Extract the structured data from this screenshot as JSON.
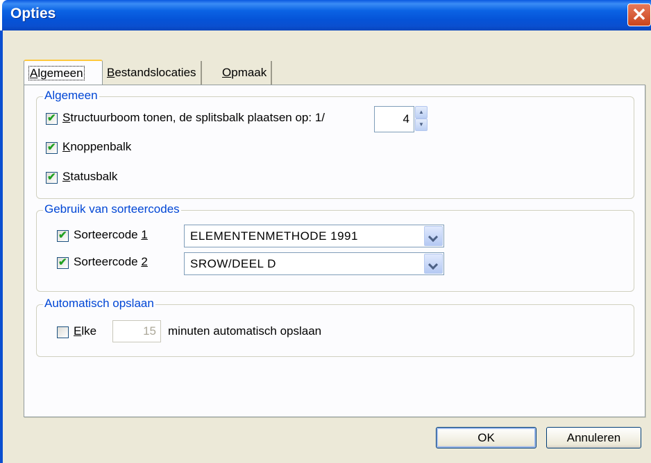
{
  "window": {
    "title": "Opties"
  },
  "tabs": [
    {
      "label": "Algemeen",
      "access_key": "A",
      "rest": "lgemeen",
      "active": true
    },
    {
      "label": "Bestandslocaties",
      "access_key": "B",
      "rest": "estandslocaties",
      "active": false
    },
    {
      "label": "Opmaak",
      "access_key": "O",
      "rest": "pmaak",
      "active": false
    }
  ],
  "general": {
    "legend": "Algemeen",
    "tree": {
      "key": "S",
      "rest": "tructuurboom tonen, de splitsbalk plaatsen op: 1/",
      "checked": true,
      "value": "4"
    },
    "toolbar": {
      "key": "K",
      "rest": "noppenbalk",
      "checked": true
    },
    "statusbar": {
      "key": "S",
      "rest": "tatusbalk",
      "checked": true
    }
  },
  "sort": {
    "legend": "Gebruik van sorteercodes",
    "code1": {
      "prefix": "Sorteercode ",
      "key": "1",
      "checked": true,
      "selected": "ELEMENTENMETHODE 1991"
    },
    "code2": {
      "prefix": "Sorteercode ",
      "key": "2",
      "checked": true,
      "selected": "SROW/DEEL D"
    }
  },
  "autosave": {
    "legend": "Automatisch opslaan",
    "key": "E",
    "rest": "lke",
    "checked": false,
    "minutes": "15",
    "suffix": "minuten automatisch opslaan"
  },
  "buttons": {
    "ok": "OK",
    "cancel": "Annuleren"
  },
  "colors": {
    "title_bar": "#0553d7",
    "legend_text": "#0046d5",
    "active_tab_highlight": "#ffc83c",
    "close_button": "#c8451c"
  }
}
